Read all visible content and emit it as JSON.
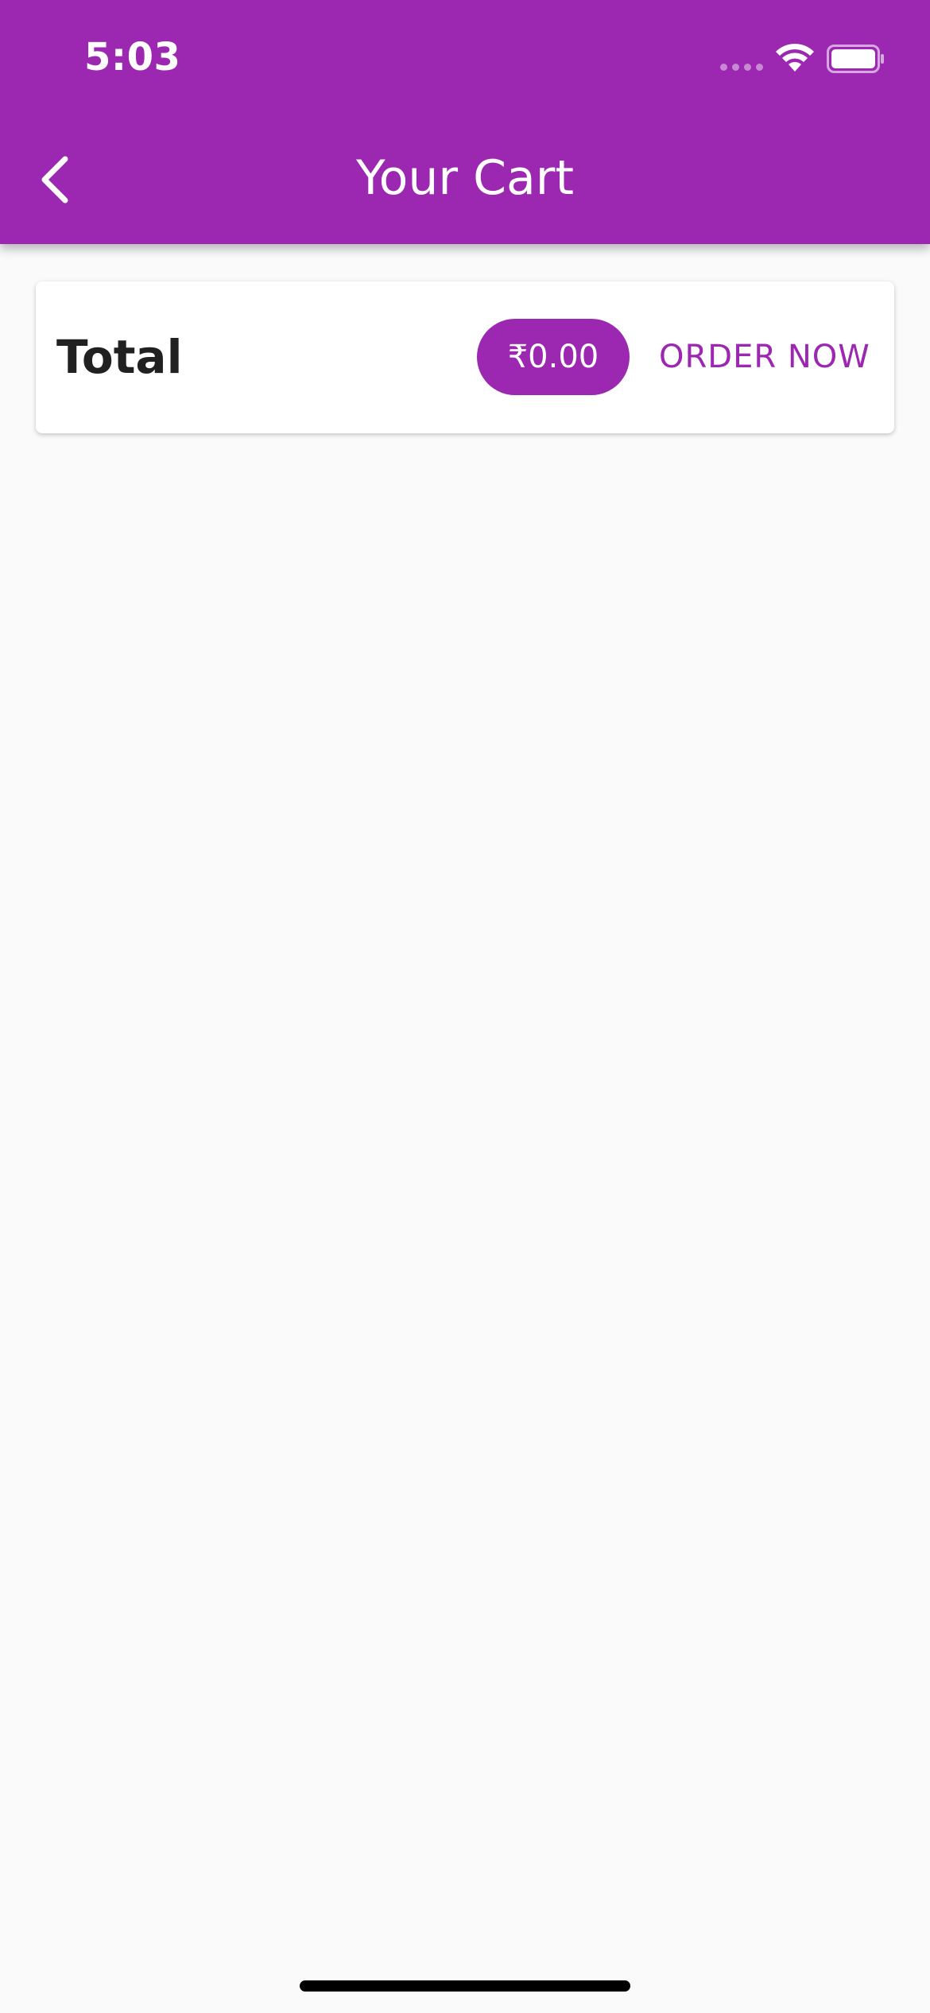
{
  "status_bar": {
    "time": "5:03"
  },
  "header": {
    "title": "Your Cart",
    "back_icon": "chevron-left-icon"
  },
  "summary": {
    "total_label": "Total",
    "total_amount": "₹0.00",
    "order_button_label": "ORDER NOW"
  },
  "colors": {
    "primary": "#9c27b0",
    "background": "#fafafa",
    "card": "#ffffff",
    "text_dark": "#212121"
  }
}
